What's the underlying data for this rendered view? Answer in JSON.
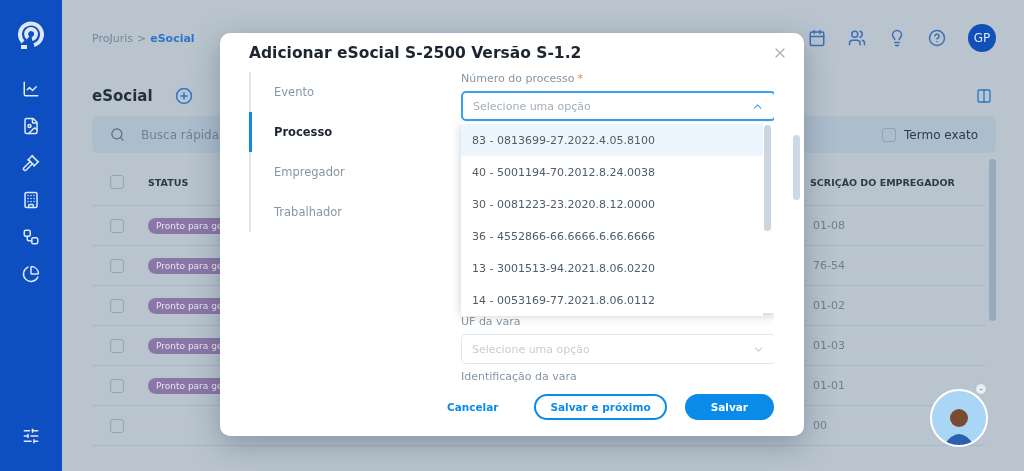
{
  "breadcrumb": {
    "items": [
      "ProJuris",
      "eSocial"
    ],
    "separator": ">"
  },
  "header": {
    "avatar_initials": "GP"
  },
  "page": {
    "title": "eSocial",
    "search": {
      "placeholder": "Busca rápida"
    },
    "exact_term": {
      "label": "Termo exato",
      "checked": false
    }
  },
  "table": {
    "select_all_checked": false,
    "columns": [
      "STATUS",
      "SCRIÇÃO DO EMPREGADOR"
    ],
    "rows": [
      {
        "checked": false,
        "status": "Pronto para ge",
        "column_2": "01-08"
      },
      {
        "checked": false,
        "status": "Pronto para ge",
        "column_2": "76-54"
      },
      {
        "checked": false,
        "status": "Pronto para ge",
        "column_2": "01-02"
      },
      {
        "checked": false,
        "status": "Pronto para ge",
        "column_2": "01-03"
      },
      {
        "checked": false,
        "status": "Pronto para ge",
        "column_2": "01-01"
      },
      {
        "checked": false,
        "status": "",
        "column_2": "00"
      }
    ]
  },
  "modal": {
    "title": "Adicionar eSocial S-2500 Versão S-1.2",
    "steps": [
      {
        "label": "Evento",
        "selected": false
      },
      {
        "label": "Processo",
        "selected": true
      },
      {
        "label": "Empregador",
        "selected": false
      },
      {
        "label": "Trabalhador",
        "selected": false
      }
    ],
    "fields": [
      {
        "label": "Número do processo",
        "required_mark": "*",
        "placeholder": "Selecione uma opção",
        "expanded": true,
        "options": [
          {
            "label": "83 - 0813699-27.2022.4.05.8100",
            "highlighted": true
          },
          {
            "label": "40 - 5001194-70.2012.8.24.0038",
            "highlighted": false
          },
          {
            "label": "30 - 0081223-23.2020.8.12.0000",
            "highlighted": false
          },
          {
            "label": "36 - 4552866-66.6666.6.66.6666",
            "highlighted": false
          },
          {
            "label": "13 - 3001513-94.2021.8.06.0220",
            "highlighted": false
          },
          {
            "label": "14 - 0053169-77.2021.8.06.0112",
            "highlighted": false
          }
        ]
      },
      {
        "label": "UF da vara",
        "placeholder": "Selecione uma opção",
        "expanded": false
      },
      {
        "label": "Identificação da vara"
      }
    ],
    "buttons": [
      {
        "label": "Cancelar",
        "kind": "text"
      },
      {
        "label": "Salvar e próximo",
        "kind": "outline"
      },
      {
        "label": "Salvar",
        "kind": "primary"
      }
    ]
  },
  "assistant": {
    "minimize": "-"
  }
}
